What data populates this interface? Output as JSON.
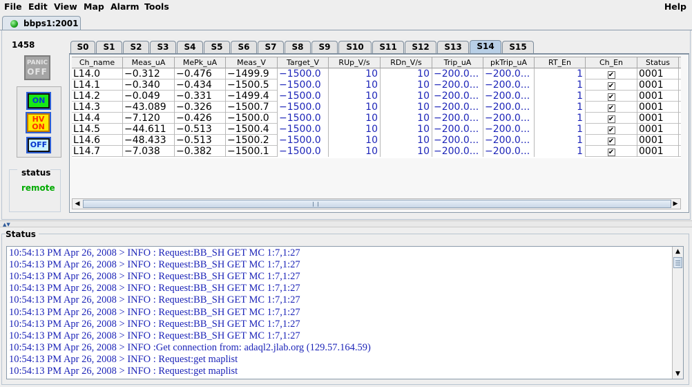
{
  "menubar": {
    "items": [
      "File",
      "Edit",
      "View",
      "Map",
      "Alarm",
      "Tools"
    ],
    "help": "Help"
  },
  "host_tab": {
    "label": "bbps1:2001",
    "status_color": "#1fa31f"
  },
  "crate": {
    "id": "1458",
    "panic_label_top": "PANIC",
    "panic_label_bottom": "OFF",
    "on_label": "ON",
    "hv_on_top": "HV",
    "hv_on_bottom": "ON",
    "off_label": "OFF",
    "status_title": "status",
    "status_value": "remote"
  },
  "slot_tabs": [
    "S0",
    "S1",
    "S2",
    "S3",
    "S4",
    "S5",
    "S6",
    "S7",
    "S8",
    "S9",
    "S10",
    "S11",
    "S12",
    "S13",
    "S14",
    "S15"
  ],
  "active_slot": "S14",
  "table": {
    "columns": [
      "Ch_name",
      "Meas_uA",
      "MePk_uA",
      "Meas_V",
      "Target_V",
      "RUp_V/s",
      "RDn_V/s",
      "Trip_uA",
      "pkTrip_uA",
      "RT_En",
      "Ch_En",
      "Status"
    ],
    "rows": [
      [
        "L14.0",
        "−0.312",
        "−0.476",
        "−1499.9",
        "−1500.0",
        "10",
        "10",
        "−200.0...",
        "−200.0...",
        "1",
        "✔",
        "0001"
      ],
      [
        "L14.1",
        "−0.340",
        "−0.434",
        "−1500.5",
        "−1500.0",
        "10",
        "10",
        "−200.0...",
        "−200.0...",
        "1",
        "✔",
        "0001"
      ],
      [
        "L14.2",
        "−0.049",
        "−0.331",
        "−1499.4",
        "−1500.0",
        "10",
        "10",
        "−200.0...",
        "−200.0...",
        "1",
        "✔",
        "0001"
      ],
      [
        "L14.3",
        "−43.089",
        "−0.326",
        "−1500.7",
        "−1500.0",
        "10",
        "10",
        "−200.0...",
        "−200.0...",
        "1",
        "✔",
        "0001"
      ],
      [
        "L14.4",
        "−7.120",
        "−0.426",
        "−1500.0",
        "−1500.0",
        "10",
        "10",
        "−200.0...",
        "−200.0...",
        "1",
        "✔",
        "0001"
      ],
      [
        "L14.5",
        "−44.611",
        "−0.513",
        "−1500.4",
        "−1500.0",
        "10",
        "10",
        "−200.0...",
        "−200.0...",
        "1",
        "✔",
        "0001"
      ],
      [
        "L14.6",
        "−48.433",
        "−0.513",
        "−1500.2",
        "−1500.0",
        "10",
        "10",
        "−200.0...",
        "−200.0...",
        "1",
        "✔",
        "0001"
      ],
      [
        "L14.7",
        "−7.038",
        "−0.382",
        "−1500.1",
        "−1500.0",
        "10",
        "10",
        "−200.0...",
        "−200.0...",
        "1",
        "✔",
        "0001"
      ]
    ]
  },
  "log": {
    "title": "Status",
    "lines": [
      "10:54:13 PM Apr 26, 2008 > INFO : Request:BB_SH GET MC 1:7,1:27",
      "10:54:13 PM Apr 26, 2008 > INFO : Request:BB_SH GET MC 1:7,1:27",
      "10:54:13 PM Apr 26, 2008 > INFO : Request:BB_SH GET MC 1:7,1:27",
      "10:54:13 PM Apr 26, 2008 > INFO : Request:BB_SH GET MC 1:7,1:27",
      "10:54:13 PM Apr 26, 2008 > INFO : Request:BB_SH GET MC 1:7,1:27",
      "10:54:13 PM Apr 26, 2008 > INFO : Request:BB_SH GET MC 1:7,1:27",
      "10:54:13 PM Apr 26, 2008 > INFO : Request:BB_SH GET MC 1:7,1:27",
      "10:54:13 PM Apr 26, 2008 > INFO : Request:BB_SH GET MC 1:7,1:27",
      "10:54:13 PM Apr 26, 2008 > INFO :Get connection from: adaql2.jlab.org (129.57.164.59)",
      "10:54:13 PM Apr 26, 2008 > INFO : Request:get maplist",
      "10:54:13 PM Apr 26, 2008 > INFO : Request:get maplist"
    ]
  }
}
